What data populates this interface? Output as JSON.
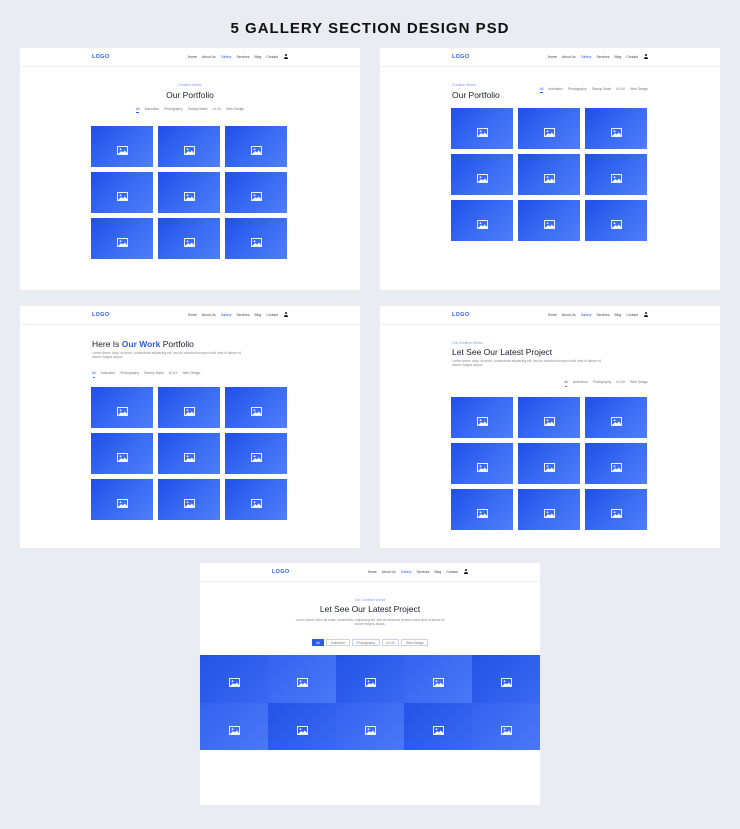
{
  "page_title": "5 GALLERY SECTION DESIGN PSD",
  "nav": {
    "logo": "LOGO",
    "items": [
      "Home",
      "About Us",
      "Gallery",
      "Services",
      "Blog",
      "Contact"
    ],
    "active": "Gallery"
  },
  "filters_long": [
    "All",
    "Animation",
    "Photography",
    "Startup Make",
    "UI UX",
    "Web Design"
  ],
  "filters_short": [
    "All",
    "Animation",
    "Photography",
    "UI UX",
    "Web Design"
  ],
  "lorem": "Lorem ipsum dolor sit amet, consectetur adipiscing elit, sed do eiusmod tempor incidi dunt ut labore et dolore magna aliqua.",
  "panel1": {
    "eyebrow": "Creative Works",
    "heading": "Our Portfolio"
  },
  "panel2": {
    "eyebrow": "Creative Works",
    "heading": "Our Portfolio"
  },
  "panel3": {
    "heading_before": "Here Is ",
    "heading_accent": "Our Work",
    "heading_after": " Portfolio"
  },
  "panel4": {
    "eyebrow": "Our Creative Works",
    "heading": "Let See Our Latest Project"
  },
  "panel5": {
    "eyebrow": "Our Creative Works",
    "heading": "Let See Our Latest Project"
  },
  "colors": {
    "accent": "#2d5be3",
    "tile": "#2f5ff0",
    "background": "#e9ecf3"
  },
  "icons": {
    "tile": "image-placeholder-icon",
    "nav_user": "user-icon"
  }
}
